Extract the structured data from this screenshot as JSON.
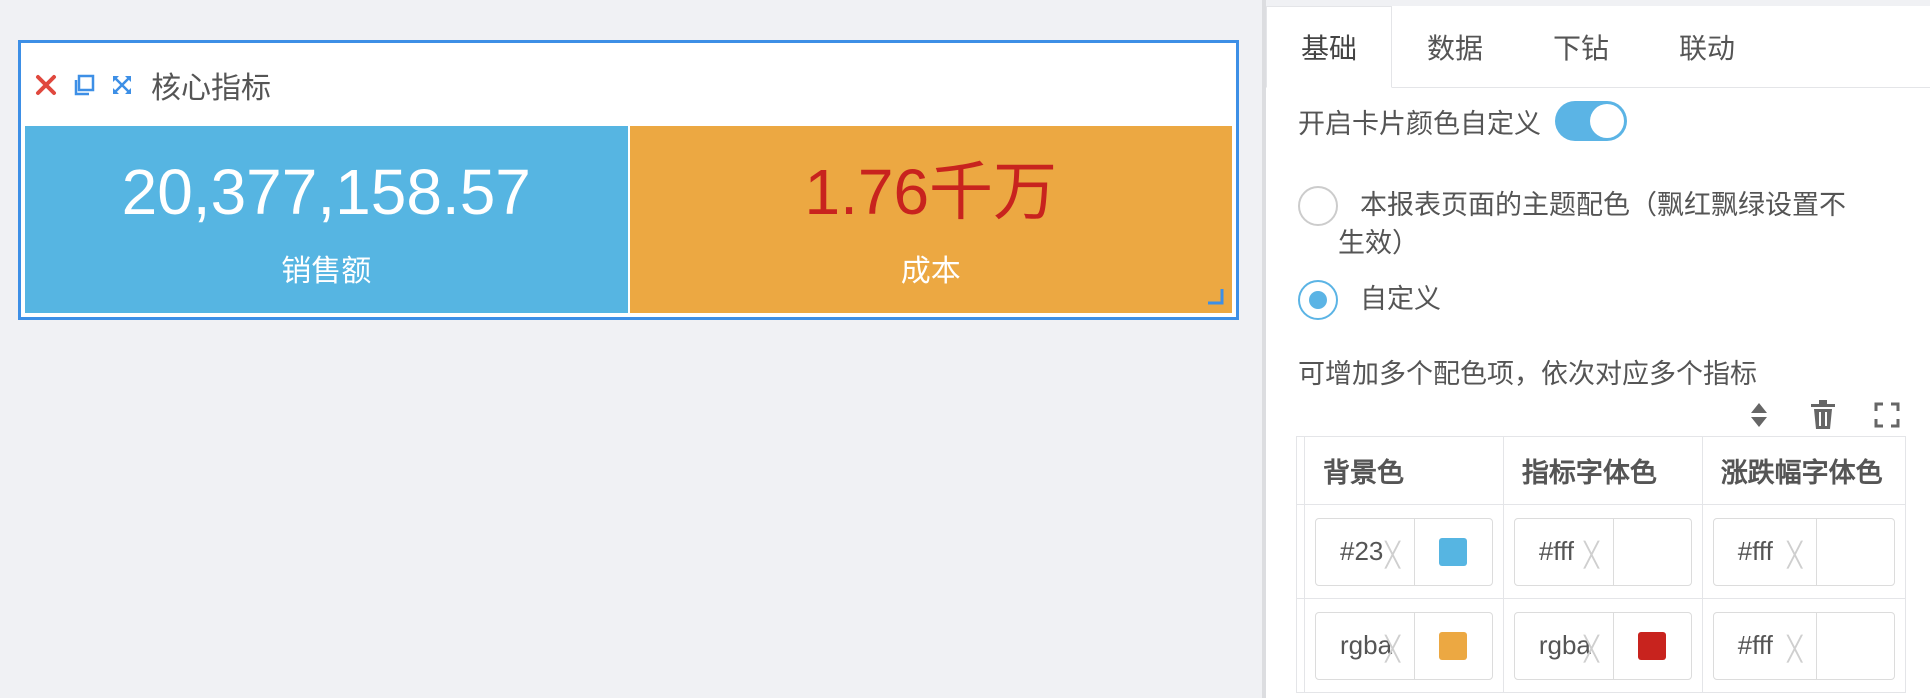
{
  "widget": {
    "title": "核心指标",
    "icons": {
      "close": "close-icon",
      "copy": "copy-icon",
      "expand": "expand-icon"
    },
    "cards": [
      {
        "value": "20,377,158.57",
        "label": "销售额",
        "bg": "#56b5e2",
        "value_color": "#ffffff"
      },
      {
        "value": "1.76千万",
        "label": "成本",
        "bg": "#eca842",
        "value_color": "#c8231e"
      }
    ]
  },
  "panel": {
    "tabs": [
      "基础",
      "数据",
      "下钻",
      "联动"
    ],
    "active_tab": "基础",
    "toggle_label": "开启卡片颜色自定义",
    "toggle_on": true,
    "radio_theme": "本报表页面的主题配色（飘红飘绿设置不生效）",
    "radio_theme_line1": "本报表页面的主题配色（飘红飘绿设置不",
    "radio_theme_line2": "生效）",
    "radio_custom": "自定义",
    "hint": "可增加多个配色项，依次对应多个指标",
    "table": {
      "headers": [
        "背景色",
        "指标字体色",
        "涨跌幅字体色"
      ],
      "rows": [
        [
          {
            "text": "#23",
            "swatch": "#56b5e2"
          },
          {
            "text": "#fff",
            "swatch": "#ffffff"
          },
          {
            "text": "#fff",
            "swatch": "#ffffff"
          }
        ],
        [
          {
            "text": "rgba",
            "swatch": "#eca842"
          },
          {
            "text": "rgba",
            "swatch": "#c8231e"
          },
          {
            "text": "#fff",
            "swatch": "#ffffff"
          }
        ]
      ]
    }
  },
  "colors": {
    "accent": "#5bb4e5",
    "selection_border": "#3d8fe6",
    "close_red": "#e0483e"
  }
}
